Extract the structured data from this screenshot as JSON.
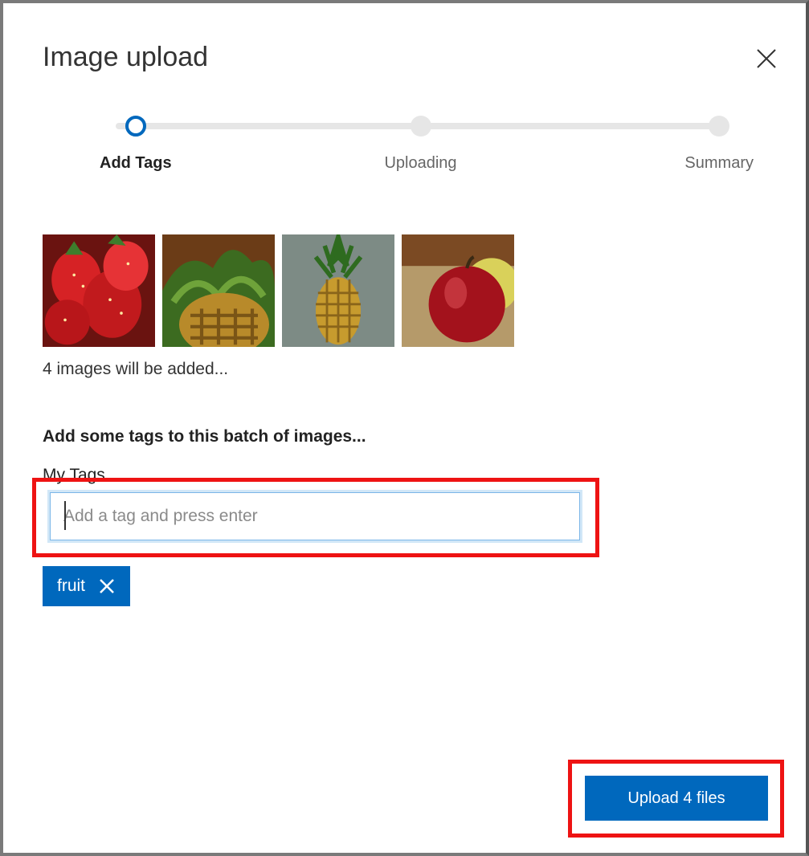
{
  "dialog": {
    "title": "Image upload"
  },
  "stepper": {
    "steps": [
      {
        "label": "Add Tags",
        "active": true
      },
      {
        "label": "Uploading",
        "active": false
      },
      {
        "label": "Summary",
        "active": false
      }
    ]
  },
  "thumbnails": {
    "count_text": "4 images will be added...",
    "items": [
      {
        "name": "strawberries"
      },
      {
        "name": "pineapple-top"
      },
      {
        "name": "pineapple"
      },
      {
        "name": "apple"
      }
    ]
  },
  "tags": {
    "prompt": "Add some tags to this batch of images...",
    "section_label": "My Tags",
    "input_placeholder": "Add a tag and press enter",
    "applied": [
      {
        "label": "fruit"
      }
    ]
  },
  "actions": {
    "upload_label": "Upload 4 files"
  }
}
